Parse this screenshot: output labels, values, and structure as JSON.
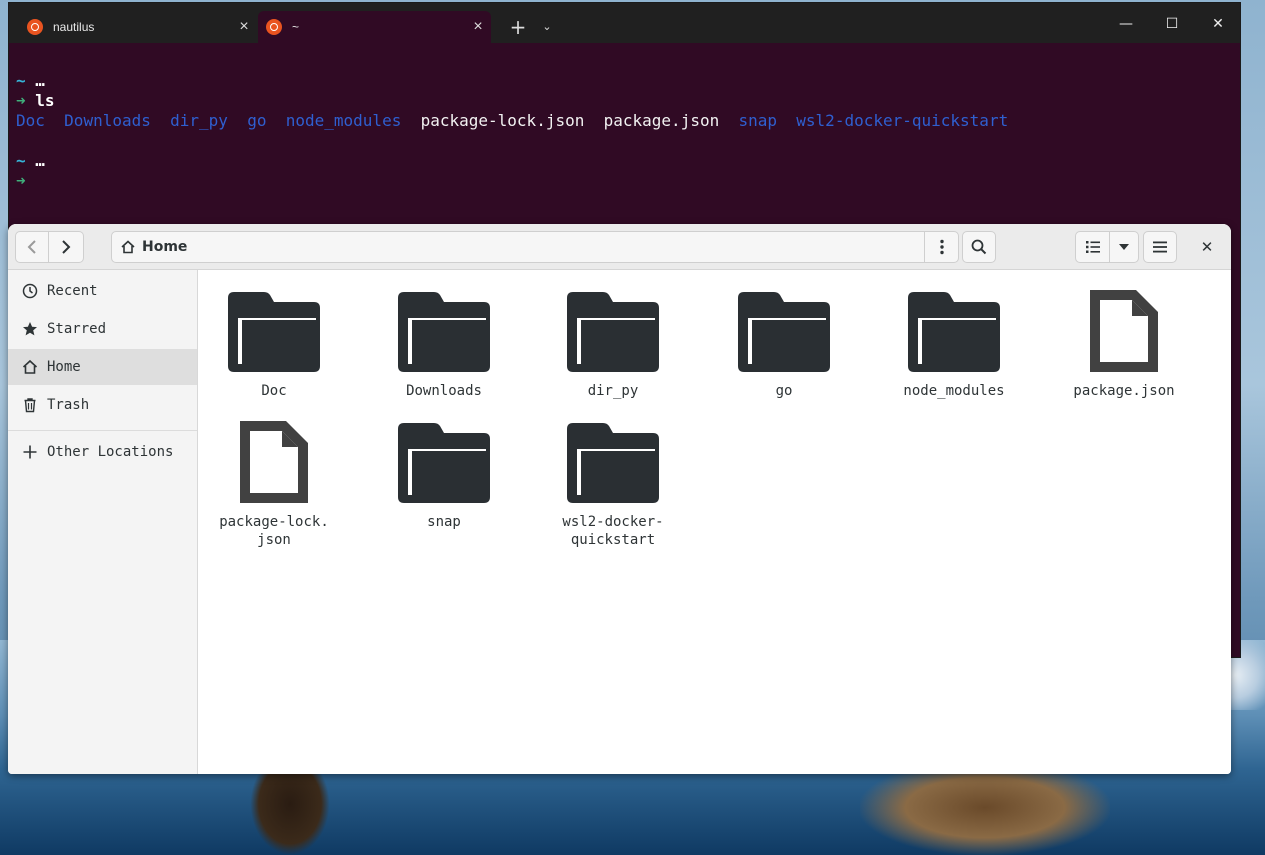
{
  "terminal": {
    "tabs": [
      {
        "label": "nautilus",
        "active": false
      },
      {
        "label": "~",
        "active": true
      }
    ],
    "new_tab_symbol": "+",
    "dropdown_symbol": "⌄",
    "window_controls": {
      "minimize": "—",
      "maximize": "☐",
      "close": "✕"
    },
    "lines": {
      "prompt1_tilde": "~",
      "prompt1_ellipsis": "…",
      "prompt_arrow": "➜",
      "command": "ls",
      "prompt2_tilde": "~",
      "prompt2_ellipsis": "…"
    },
    "ls_output": [
      {
        "name": "Doc",
        "type": "dir"
      },
      {
        "name": "Downloads",
        "type": "dir"
      },
      {
        "name": "dir_py",
        "type": "dir"
      },
      {
        "name": "go",
        "type": "dir"
      },
      {
        "name": "node_modules",
        "type": "dir"
      },
      {
        "name": "package-lock.json",
        "type": "file"
      },
      {
        "name": "package.json",
        "type": "file"
      },
      {
        "name": "snap",
        "type": "dir"
      },
      {
        "name": "wsl2-docker-quickstart",
        "type": "dir"
      }
    ],
    "colors": {
      "background": "#300a24",
      "dir": "#2f5fd0",
      "tilde": "#36b4d8",
      "arrow": "#3fb07b"
    }
  },
  "nautilus": {
    "location": "Home",
    "location_icon": "home-icon",
    "sidebar": {
      "items": [
        {
          "label": "Recent",
          "icon": "clock-icon",
          "active": false
        },
        {
          "label": "Starred",
          "icon": "star-icon",
          "active": false
        },
        {
          "label": "Home",
          "icon": "home-icon",
          "active": true
        },
        {
          "label": "Trash",
          "icon": "trash-icon",
          "active": false
        },
        {
          "label": "Other Locations",
          "icon": "plus-icon",
          "active": false
        }
      ]
    },
    "files": [
      {
        "name": "Doc",
        "type": "folder"
      },
      {
        "name": "Downloads",
        "type": "folder"
      },
      {
        "name": "dir_py",
        "type": "folder"
      },
      {
        "name": "go",
        "type": "folder"
      },
      {
        "name": "node_modules",
        "type": "folder"
      },
      {
        "name": "package.json",
        "type": "file"
      },
      {
        "name": "package-lock.\njson",
        "type": "file"
      },
      {
        "name": "snap",
        "type": "folder"
      },
      {
        "name": "wsl2-docker-\nquickstart",
        "type": "folder"
      }
    ],
    "close_symbol": "✕"
  }
}
